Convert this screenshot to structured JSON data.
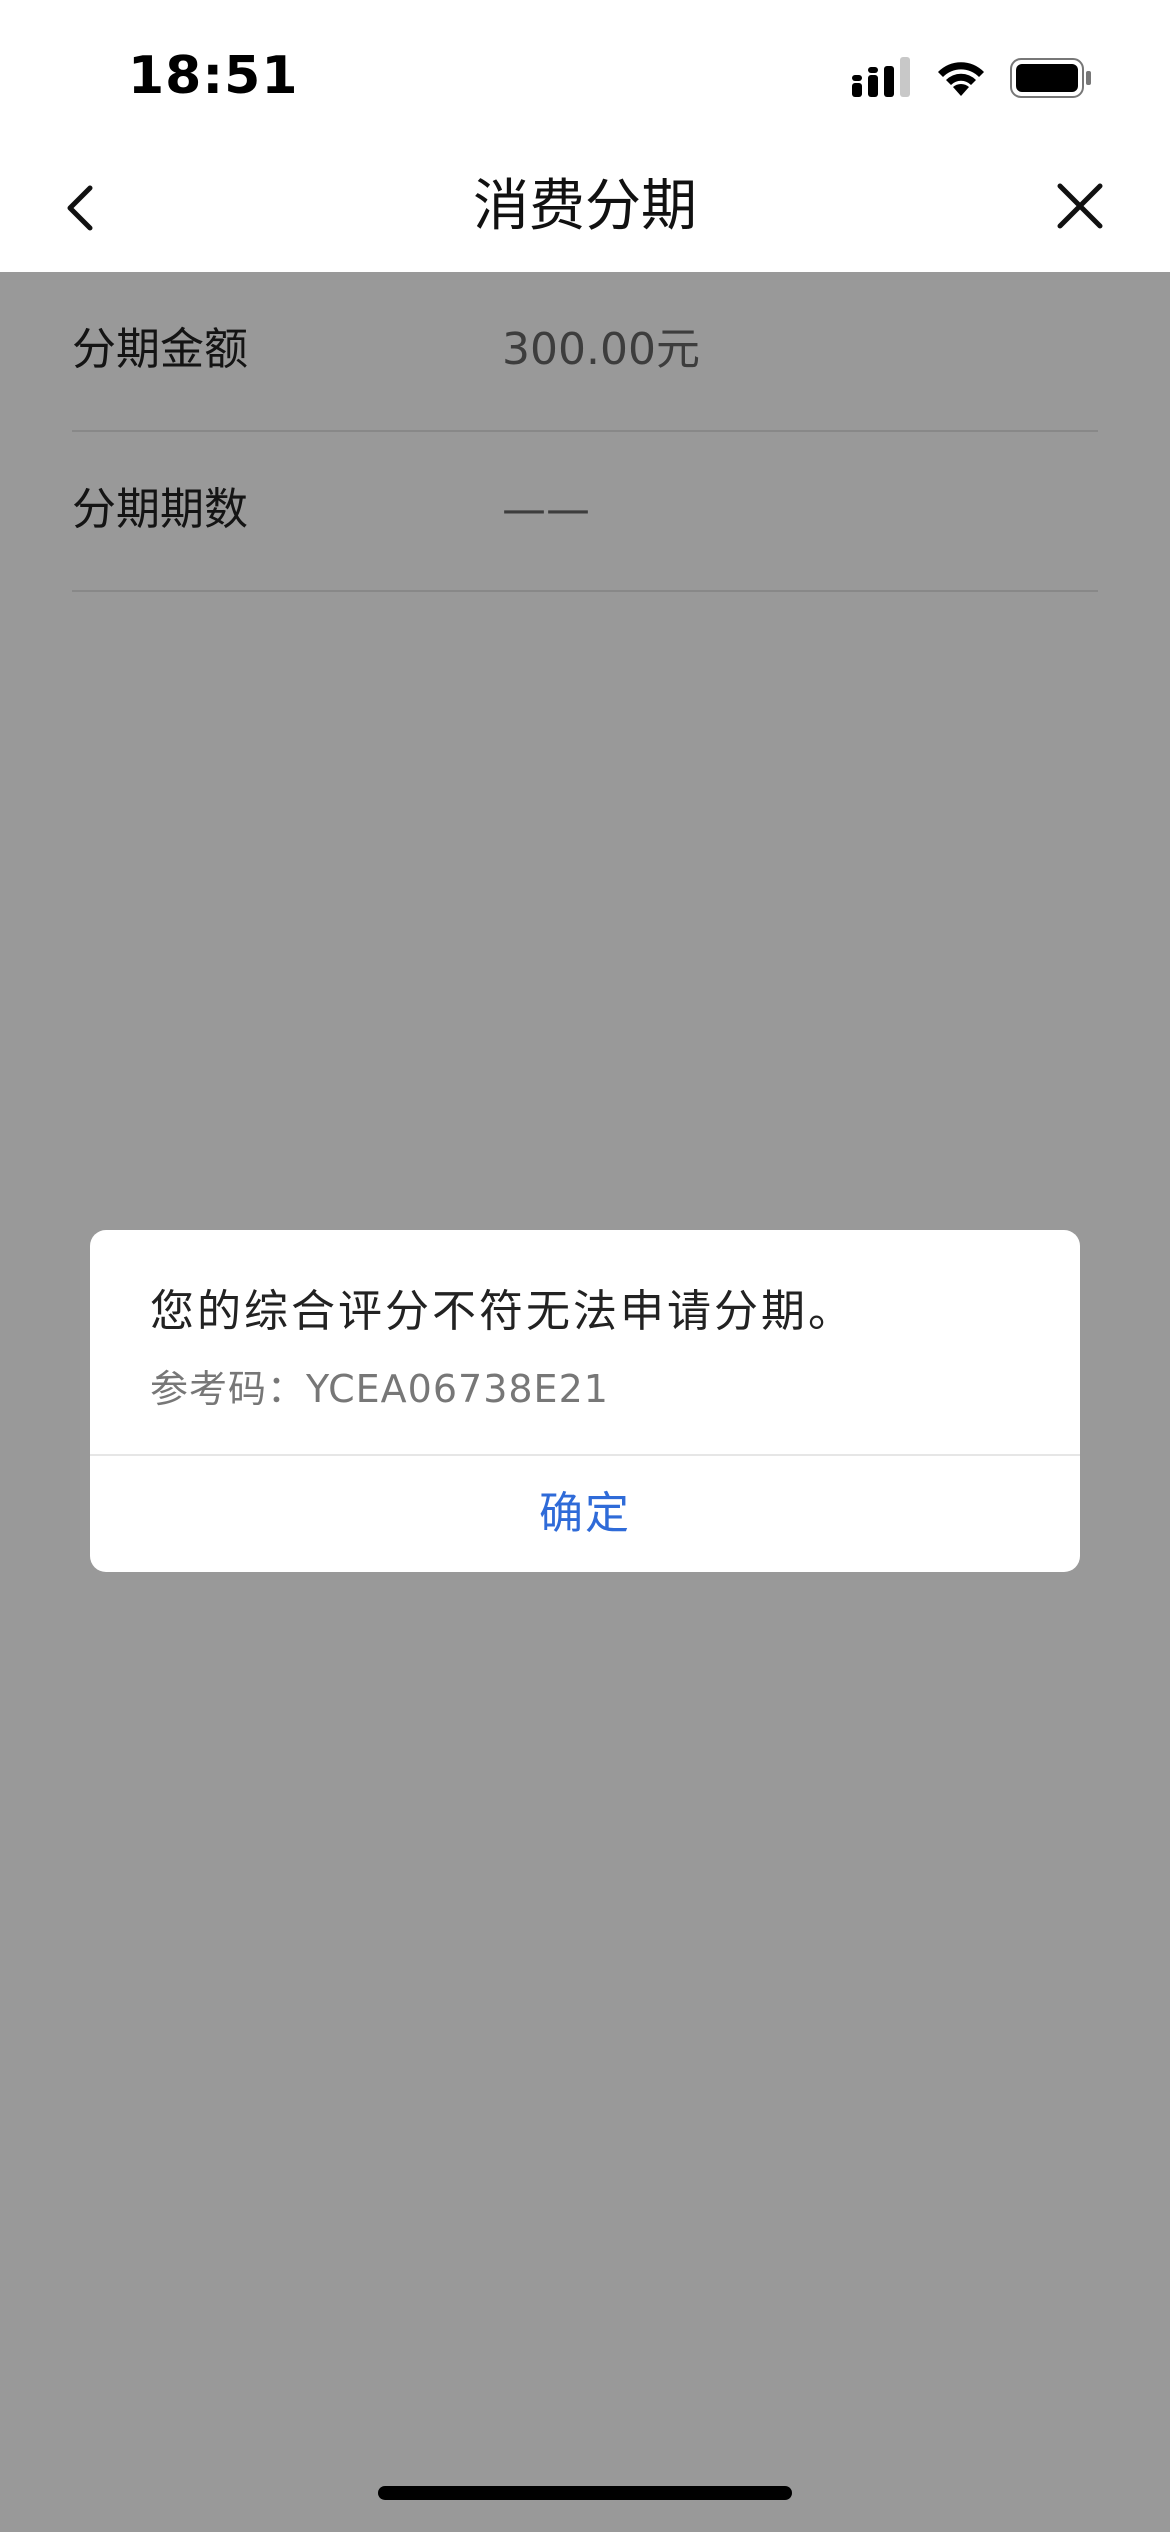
{
  "status_bar": {
    "time": "18:51",
    "icons": [
      "cellular-signal-icon",
      "wifi-icon",
      "battery-icon"
    ]
  },
  "nav": {
    "title": "消费分期",
    "back_icon": "chevron-left-icon",
    "close_icon": "close-icon"
  },
  "details": [
    {
      "label": "分期金额",
      "value": "300.00元"
    },
    {
      "label": "分期期数",
      "value": "——"
    }
  ],
  "dialog": {
    "message": "您的综合评分不符无法申请分期。",
    "reference": "参考码：YCEA06738E21",
    "confirm_label": "确定"
  },
  "colors": {
    "accent": "#2f6bd8",
    "overlay": "#000000"
  }
}
